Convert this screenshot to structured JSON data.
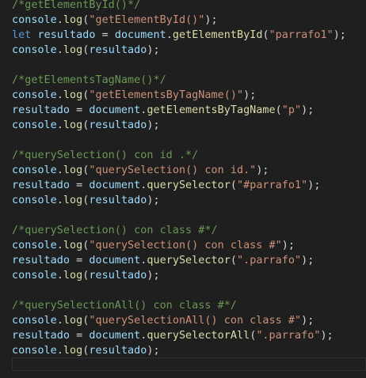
{
  "code_lines": [
    {
      "tokens": [
        {
          "text": "/*getElementById()*/",
          "type": "comment"
        }
      ]
    },
    {
      "tokens": [
        {
          "text": "console",
          "type": "var"
        },
        {
          "text": ".",
          "type": "punct"
        },
        {
          "text": "log",
          "type": "fn"
        },
        {
          "text": "(",
          "type": "punct"
        },
        {
          "text": "\"getElementById()\"",
          "type": "string"
        },
        {
          "text": ");",
          "type": "punct"
        }
      ]
    },
    {
      "tokens": [
        {
          "text": "let",
          "type": "keyword"
        },
        {
          "text": " ",
          "type": "punct"
        },
        {
          "text": "resultado",
          "type": "var"
        },
        {
          "text": " = ",
          "type": "punct"
        },
        {
          "text": "document",
          "type": "var"
        },
        {
          "text": ".",
          "type": "punct"
        },
        {
          "text": "getElementById",
          "type": "fn"
        },
        {
          "text": "(",
          "type": "punct"
        },
        {
          "text": "\"parrafo1\"",
          "type": "string"
        },
        {
          "text": ");",
          "type": "punct"
        }
      ]
    },
    {
      "tokens": [
        {
          "text": "console",
          "type": "var"
        },
        {
          "text": ".",
          "type": "punct"
        },
        {
          "text": "log",
          "type": "fn"
        },
        {
          "text": "(",
          "type": "punct"
        },
        {
          "text": "resultado",
          "type": "var"
        },
        {
          "text": ");",
          "type": "punct"
        }
      ]
    },
    {
      "tokens": []
    },
    {
      "tokens": [
        {
          "text": "/*getElementsTagName()*/",
          "type": "comment"
        }
      ]
    },
    {
      "tokens": [
        {
          "text": "console",
          "type": "var"
        },
        {
          "text": ".",
          "type": "punct"
        },
        {
          "text": "log",
          "type": "fn"
        },
        {
          "text": "(",
          "type": "punct"
        },
        {
          "text": "\"getElementsByTagName()\"",
          "type": "string"
        },
        {
          "text": ");",
          "type": "punct"
        }
      ]
    },
    {
      "tokens": [
        {
          "text": "resultado",
          "type": "var"
        },
        {
          "text": " = ",
          "type": "punct"
        },
        {
          "text": "document",
          "type": "var"
        },
        {
          "text": ".",
          "type": "punct"
        },
        {
          "text": "getElementsByTagName",
          "type": "fn"
        },
        {
          "text": "(",
          "type": "punct"
        },
        {
          "text": "\"p\"",
          "type": "string"
        },
        {
          "text": ");",
          "type": "punct"
        }
      ]
    },
    {
      "tokens": [
        {
          "text": "console",
          "type": "var"
        },
        {
          "text": ".",
          "type": "punct"
        },
        {
          "text": "log",
          "type": "fn"
        },
        {
          "text": "(",
          "type": "punct"
        },
        {
          "text": "resultado",
          "type": "var"
        },
        {
          "text": ");",
          "type": "punct"
        }
      ]
    },
    {
      "tokens": []
    },
    {
      "tokens": [
        {
          "text": "/*querySelection() con id .*/",
          "type": "comment"
        }
      ]
    },
    {
      "tokens": [
        {
          "text": "console",
          "type": "var"
        },
        {
          "text": ".",
          "type": "punct"
        },
        {
          "text": "log",
          "type": "fn"
        },
        {
          "text": "(",
          "type": "punct"
        },
        {
          "text": "\"querySelection() con id.\"",
          "type": "string"
        },
        {
          "text": ");",
          "type": "punct"
        }
      ]
    },
    {
      "tokens": [
        {
          "text": "resultado",
          "type": "var"
        },
        {
          "text": " = ",
          "type": "punct"
        },
        {
          "text": "document",
          "type": "var"
        },
        {
          "text": ".",
          "type": "punct"
        },
        {
          "text": "querySelector",
          "type": "fn"
        },
        {
          "text": "(",
          "type": "punct"
        },
        {
          "text": "\"#parrafo1\"",
          "type": "string"
        },
        {
          "text": ");",
          "type": "punct"
        }
      ]
    },
    {
      "tokens": [
        {
          "text": "console",
          "type": "var"
        },
        {
          "text": ".",
          "type": "punct"
        },
        {
          "text": "log",
          "type": "fn"
        },
        {
          "text": "(",
          "type": "punct"
        },
        {
          "text": "resultado",
          "type": "var"
        },
        {
          "text": ");",
          "type": "punct"
        }
      ]
    },
    {
      "tokens": []
    },
    {
      "tokens": [
        {
          "text": "/*querySelection() con class #*/",
          "type": "comment"
        }
      ]
    },
    {
      "tokens": [
        {
          "text": "console",
          "type": "var"
        },
        {
          "text": ".",
          "type": "punct"
        },
        {
          "text": "log",
          "type": "fn"
        },
        {
          "text": "(",
          "type": "punct"
        },
        {
          "text": "\"querySelection() con class #\"",
          "type": "string"
        },
        {
          "text": ");",
          "type": "punct"
        }
      ]
    },
    {
      "tokens": [
        {
          "text": "resultado",
          "type": "var"
        },
        {
          "text": " = ",
          "type": "punct"
        },
        {
          "text": "document",
          "type": "var"
        },
        {
          "text": ".",
          "type": "punct"
        },
        {
          "text": "querySelector",
          "type": "fn"
        },
        {
          "text": "(",
          "type": "punct"
        },
        {
          "text": "\".parrafo\"",
          "type": "string"
        },
        {
          "text": ");",
          "type": "punct"
        }
      ]
    },
    {
      "tokens": [
        {
          "text": "console",
          "type": "var"
        },
        {
          "text": ".",
          "type": "punct"
        },
        {
          "text": "log",
          "type": "fn"
        },
        {
          "text": "(",
          "type": "punct"
        },
        {
          "text": "resultado",
          "type": "var"
        },
        {
          "text": ");",
          "type": "punct"
        }
      ]
    },
    {
      "tokens": []
    },
    {
      "tokens": [
        {
          "text": "/*querySelectionAll() con class #*/",
          "type": "comment"
        }
      ]
    },
    {
      "tokens": [
        {
          "text": "console",
          "type": "var"
        },
        {
          "text": ".",
          "type": "punct"
        },
        {
          "text": "log",
          "type": "fn"
        },
        {
          "text": "(",
          "type": "punct"
        },
        {
          "text": "\"querySelectionAll() con class #\"",
          "type": "string"
        },
        {
          "text": ");",
          "type": "punct"
        }
      ]
    },
    {
      "tokens": [
        {
          "text": "resultado",
          "type": "var"
        },
        {
          "text": " = ",
          "type": "punct"
        },
        {
          "text": "document",
          "type": "var"
        },
        {
          "text": ".",
          "type": "punct"
        },
        {
          "text": "querySelectorAll",
          "type": "fn"
        },
        {
          "text": "(",
          "type": "punct"
        },
        {
          "text": "\".parrafo\"",
          "type": "string"
        },
        {
          "text": ");",
          "type": "punct"
        }
      ]
    },
    {
      "tokens": [
        {
          "text": "console",
          "type": "var"
        },
        {
          "text": ".",
          "type": "punct"
        },
        {
          "text": "log",
          "type": "fn"
        },
        {
          "text": "(",
          "type": "punct"
        },
        {
          "text": "resultado",
          "type": "var"
        },
        {
          "text": ");",
          "type": "punct"
        }
      ]
    }
  ],
  "colors": {
    "background": "#1f1f1f",
    "comment": "#6a9955",
    "variable": "#9cdcfe",
    "function": "#dcdcaa",
    "string": "#ce9178",
    "keyword": "#569cd6",
    "punctuation": "#d4d4d4",
    "current_line_border": "#2f2f2f"
  }
}
